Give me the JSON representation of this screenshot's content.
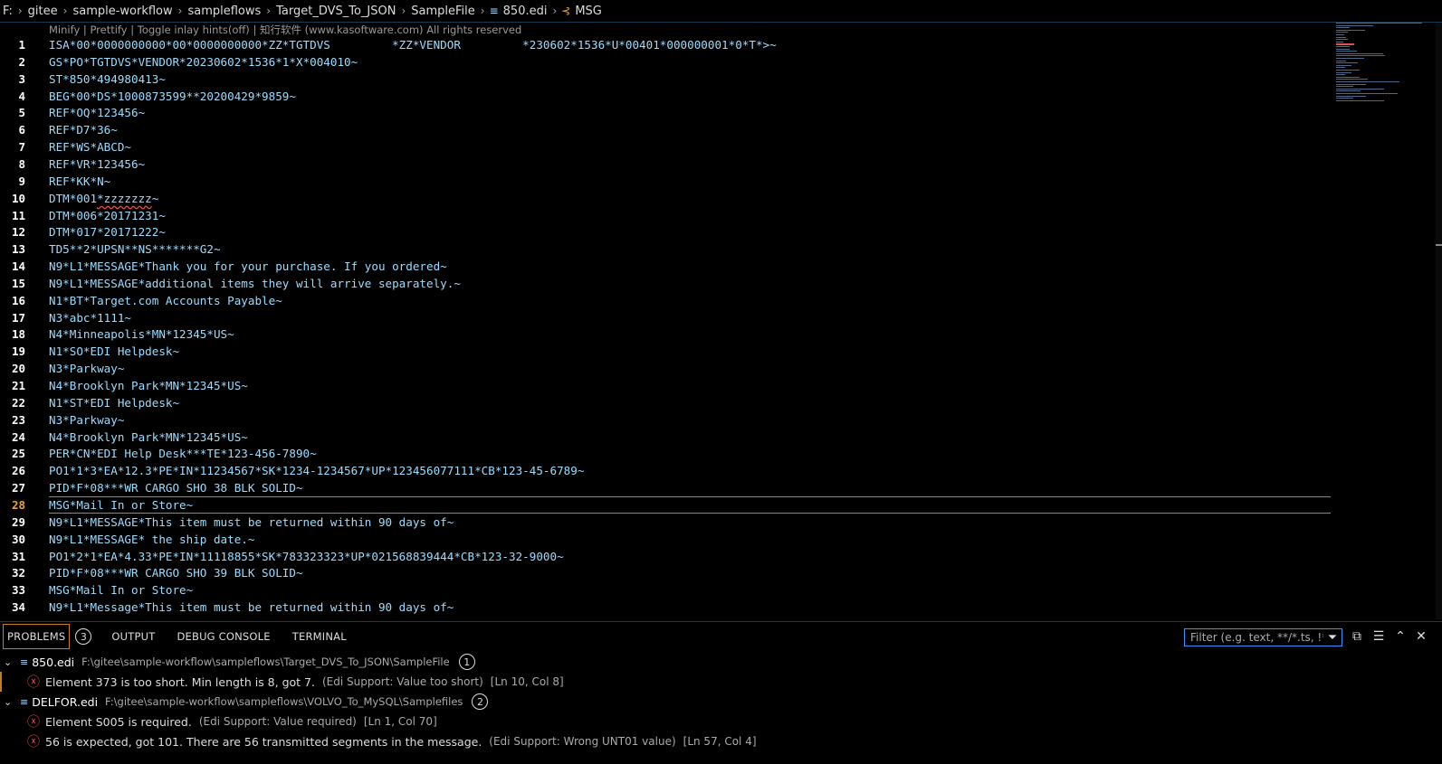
{
  "breadcrumb": [
    "F:",
    "gitee",
    "sample-workflow",
    "sampleflows",
    "Target_DVS_To_JSON",
    "SampleFile",
    "850.edi",
    "MSG"
  ],
  "codelens": "Minify | Prettify | Toggle inlay hints(off) | 知行软件 (www.kasoftware.com) All rights reserved",
  "current_line": 28,
  "lines": [
    {
      "n": "1",
      "t": "ISA*00*0000000000*00*0000000000*ZZ*TGTDVS         *ZZ*VENDOR         *230602*1536*U*00401*000000001*0*T*>~"
    },
    {
      "n": "2",
      "t": "GS*PO*TGTDVS*VENDOR*20230602*1536*1*X*004010~"
    },
    {
      "n": "3",
      "t": "ST*850*494980413~"
    },
    {
      "n": "4",
      "t": "BEG*00*DS*1000873599**20200429*9859~"
    },
    {
      "n": "5",
      "t": "REF*OQ*123456~"
    },
    {
      "n": "6",
      "t": "REF*D7*36~"
    },
    {
      "n": "7",
      "t": "REF*WS*ABCD~"
    },
    {
      "n": "8",
      "t": "REF*VR*123456~"
    },
    {
      "n": "9",
      "t": "REF*KK*N~"
    },
    {
      "n": "10",
      "t": "DTM*001*zzzzzzz~"
    },
    {
      "n": "11",
      "t": "DTM*006*20171231~"
    },
    {
      "n": "12",
      "t": "DTM*017*20171222~"
    },
    {
      "n": "13",
      "t": "TD5**2*UPSN**NS*******G2~"
    },
    {
      "n": "14",
      "t": "N9*L1*MESSAGE*Thank you for your purchase. If you ordered~"
    },
    {
      "n": "15",
      "t": "N9*L1*MESSAGE*additional items they will arrive separately.~"
    },
    {
      "n": "16",
      "t": "N1*BT*Target.com Accounts Payable~"
    },
    {
      "n": "17",
      "t": "N3*abc*1111~"
    },
    {
      "n": "18",
      "t": "N4*Minneapolis*MN*12345*US~"
    },
    {
      "n": "19",
      "t": "N1*SO*EDI Helpdesk~"
    },
    {
      "n": "20",
      "t": "N3*Parkway~"
    },
    {
      "n": "21",
      "t": "N4*Brooklyn Park*MN*12345*US~"
    },
    {
      "n": "22",
      "t": "N1*ST*EDI Helpdesk~"
    },
    {
      "n": "23",
      "t": "N3*Parkway~"
    },
    {
      "n": "24",
      "t": "N4*Brooklyn Park*MN*12345*US~"
    },
    {
      "n": "25",
      "t": "PER*CN*EDI Help Desk***TE*123-456-7890~"
    },
    {
      "n": "26",
      "t": "PO1*1*3*EA*12.3*PE*IN*11234567*SK*1234-1234567*UP*123456077111*CB*123-45-6789~"
    },
    {
      "n": "27",
      "t": "PID*F*08***WR CARGO SHO 38 BLK SOLID~"
    },
    {
      "n": "28",
      "t": "MSG*Mail In or Store~"
    },
    {
      "n": "29",
      "t": "N9*L1*MESSAGE*This item must be returned within 90 days of~"
    },
    {
      "n": "30",
      "t": "N9*L1*MESSAGE* the ship date.~"
    },
    {
      "n": "31",
      "t": "PO1*2*1*EA*4.33*PE*IN*11118855*SK*783323323*UP*021568839444*CB*123-32-9000~"
    },
    {
      "n": "32",
      "t": "PID*F*08***WR CARGO SHO 39 BLK SOLID~"
    },
    {
      "n": "33",
      "t": "MSG*Mail In or Store~"
    },
    {
      "n": "34",
      "t": "N9*L1*Message*This item must be returned within 90 days of~"
    }
  ],
  "panel": {
    "tabs": [
      {
        "label": "PROBLEMS",
        "badge": "3"
      },
      {
        "label": "OUTPUT"
      },
      {
        "label": "DEBUG CONSOLE"
      },
      {
        "label": "TERMINAL"
      }
    ],
    "filter_placeholder": "Filter (e.g. text, **/*.ts, !**/...",
    "files": [
      {
        "name": "850.edi",
        "path": "F:\\gitee\\sample-workflow\\sampleflows\\Target_DVS_To_JSON\\SampleFile",
        "count": "1",
        "problems": [
          {
            "msg": "Element 373 is too short. Min length is 8, got 7.",
            "src": "(Edi Support: Value too short)",
            "pos": "[Ln 10, Col 8]"
          }
        ]
      },
      {
        "name": "DELFOR.edi",
        "path": "F:\\gitee\\sample-workflow\\sampleflows\\VOLVO_To_MySQL\\Samplefiles",
        "count": "2",
        "problems": [
          {
            "msg": "Element S005 is required.",
            "src": "(Edi Support: Value required)",
            "pos": "[Ln 1, Col 70]"
          },
          {
            "msg": "56 is expected, got 101. There are 56 transmitted segments in the message.",
            "src": "(Edi Support: Wrong UNT01 value)",
            "pos": "[Ln 57, Col 4]"
          }
        ]
      }
    ]
  },
  "colors": {
    "segment": "#9cdcfe",
    "highlight": "#c77d1a",
    "error": "#f14c4c"
  }
}
